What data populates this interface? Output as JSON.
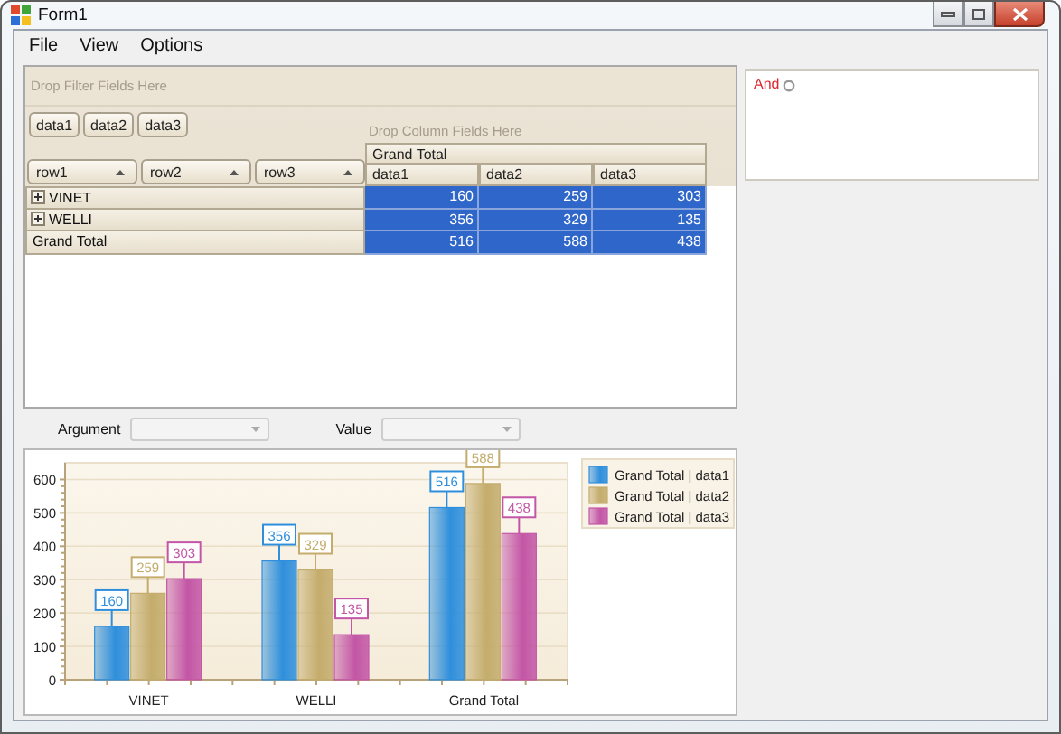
{
  "window": {
    "title": "Form1"
  },
  "menu": [
    "File",
    "View",
    "Options"
  ],
  "pivot": {
    "filter_area": "Drop Filter Fields Here",
    "data_fields": [
      "data1",
      "data2",
      "data3"
    ],
    "column_area": "Drop Column Fields Here",
    "row_fields": [
      "row1",
      "row2",
      "row3"
    ],
    "column_header": "Grand Total",
    "columns": [
      "data1",
      "data2",
      "data3"
    ],
    "rows": [
      {
        "label": "VINET",
        "kind": "group",
        "expanded": false,
        "selected": true,
        "values": [
          "160",
          "259",
          "303"
        ]
      },
      {
        "label": "WELLI",
        "kind": "group",
        "expanded": false,
        "selected": true,
        "values": [
          "356",
          "329",
          "135"
        ]
      },
      {
        "label": "Grand Total",
        "kind": "total",
        "selected": true,
        "values": [
          "516",
          "588",
          "438"
        ]
      }
    ]
  },
  "filter_panel": {
    "operator": "And"
  },
  "selectors": [
    {
      "label": "Argument",
      "disabled": true
    },
    {
      "label": "Value",
      "disabled": true
    }
  ],
  "chart": {
    "chart_data": {
      "type": "bar",
      "categories": [
        "VINET",
        "WELLI",
        "Grand Total"
      ],
      "series": [
        {
          "name": "Grand Total | data1",
          "color": "#2f8fdc",
          "values": [
            160,
            356,
            516
          ]
        },
        {
          "name": "Grand Total | data2",
          "color": "#c4ac6c",
          "values": [
            259,
            329,
            588
          ]
        },
        {
          "name": "Grand Total | data3",
          "color": "#c356a6",
          "values": [
            303,
            135,
            438
          ]
        }
      ],
      "grid": true,
      "legend": true,
      "ylim": [
        0,
        650
      ],
      "yticks": [
        0,
        100,
        200,
        300,
        400,
        500,
        600
      ],
      "data_labels": true
    }
  }
}
